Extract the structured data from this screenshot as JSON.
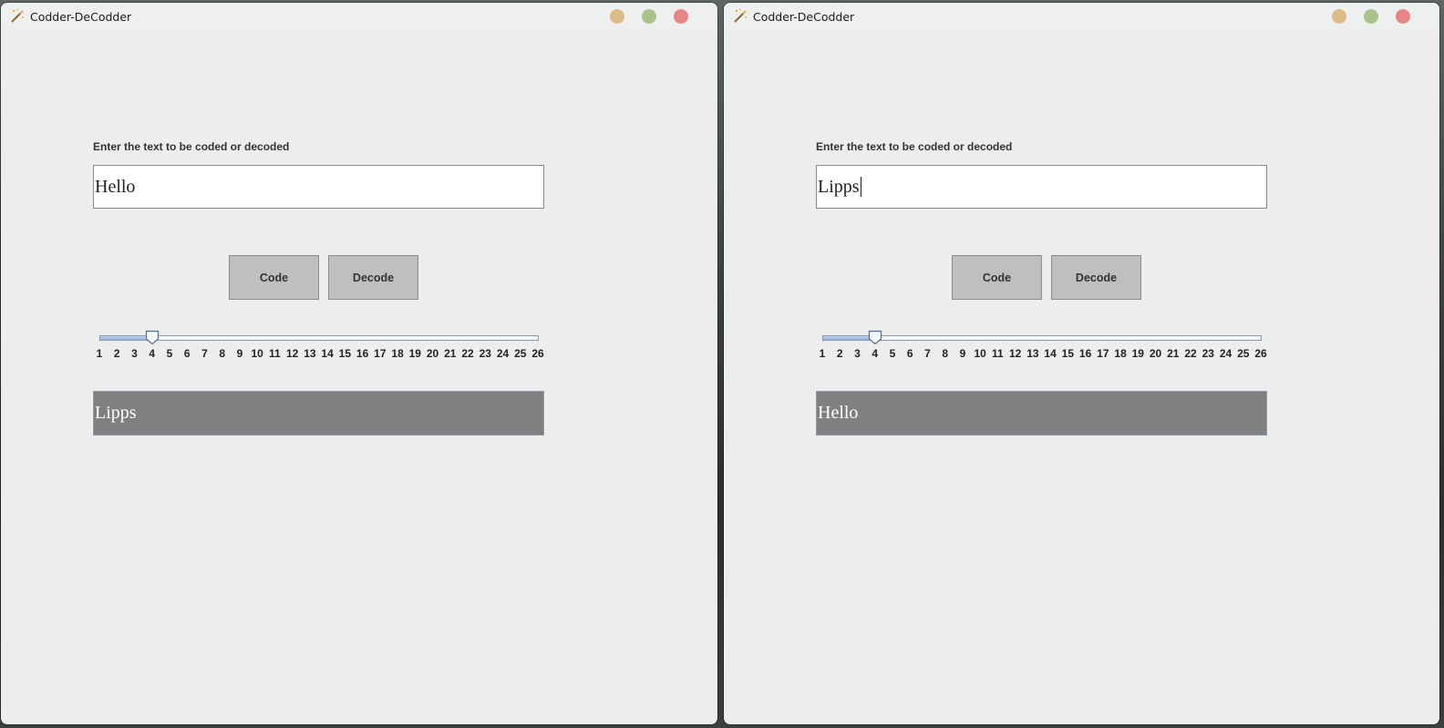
{
  "slider_range": {
    "min": 1,
    "max": 26
  },
  "tick_labels": [
    "1",
    "2",
    "3",
    "4",
    "5",
    "6",
    "7",
    "8",
    "9",
    "10",
    "11",
    "12",
    "13",
    "14",
    "15",
    "16",
    "17",
    "18",
    "19",
    "20",
    "21",
    "22",
    "23",
    "24",
    "25",
    "26"
  ],
  "colors": {
    "titlebar": "#eef0ef",
    "window_bg": "#ededed",
    "button_bg": "#bfbfbf",
    "output_bg": "#808080",
    "minimize": "#dcbc86",
    "maximize": "#a9c38a",
    "close": "#e88585"
  },
  "windows": [
    {
      "title": "Codder-DeCodder",
      "icon": "magic-wand-icon",
      "prompt_label": "Enter the text to be coded or decoded",
      "input_value": "Hello",
      "input_focused": false,
      "code_label": "Code",
      "decode_label": "Decode",
      "slider_value": 4,
      "output_text": "Lipps"
    },
    {
      "title": "Codder-DeCodder",
      "icon": "magic-wand-icon",
      "prompt_label": "Enter the text to be coded or decoded",
      "input_value": "Lipps",
      "input_focused": true,
      "code_label": "Code",
      "decode_label": "Decode",
      "slider_value": 4,
      "output_text": "Hello"
    }
  ]
}
